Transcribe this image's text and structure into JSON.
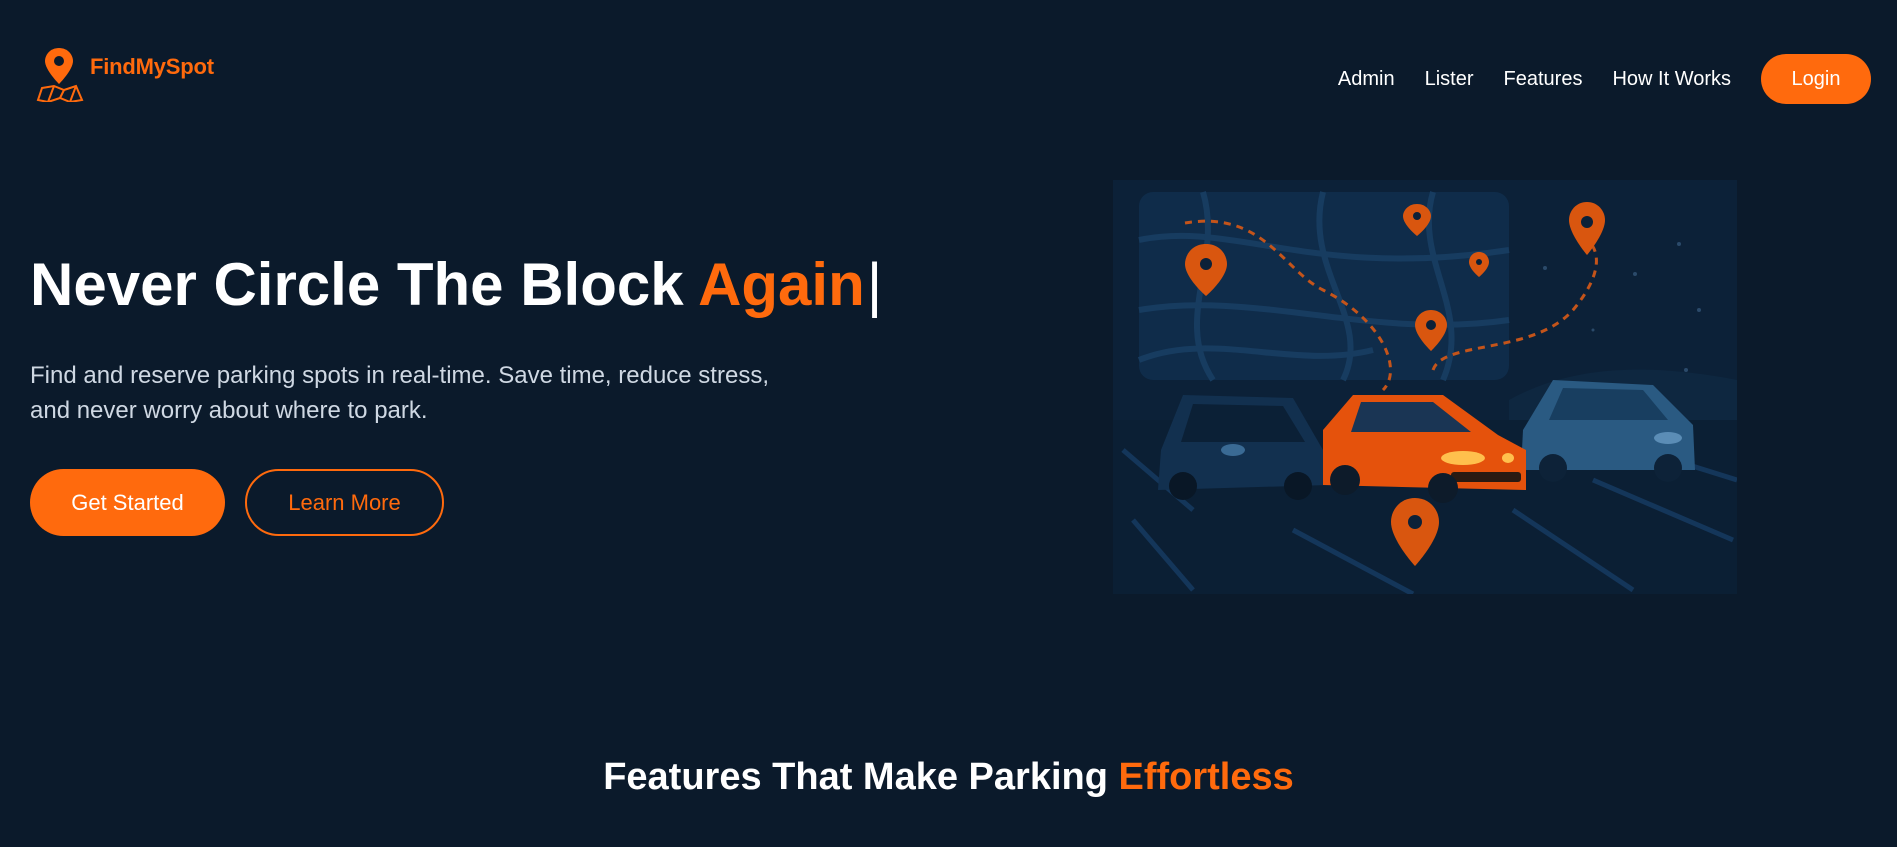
{
  "brand": {
    "name": "FindMySpot",
    "accent_color": "#ff6a0d",
    "background": "#0b1a2b"
  },
  "nav": {
    "links": [
      "Admin",
      "Lister",
      "Features",
      "How It Works"
    ],
    "login_label": "Login"
  },
  "hero": {
    "title_main": "Never Circle The Block ",
    "title_accent": "Again",
    "caret": "|",
    "description": "Find and reserve parking spots in real-time. Save time, reduce stress, and never worry about where to park.",
    "primary_button": "Get Started",
    "secondary_button": "Learn More",
    "illustration_icon": "car-parking-map-illustration"
  },
  "features": {
    "title_main": "Features That Make Parking ",
    "title_accent": "Effortless"
  }
}
